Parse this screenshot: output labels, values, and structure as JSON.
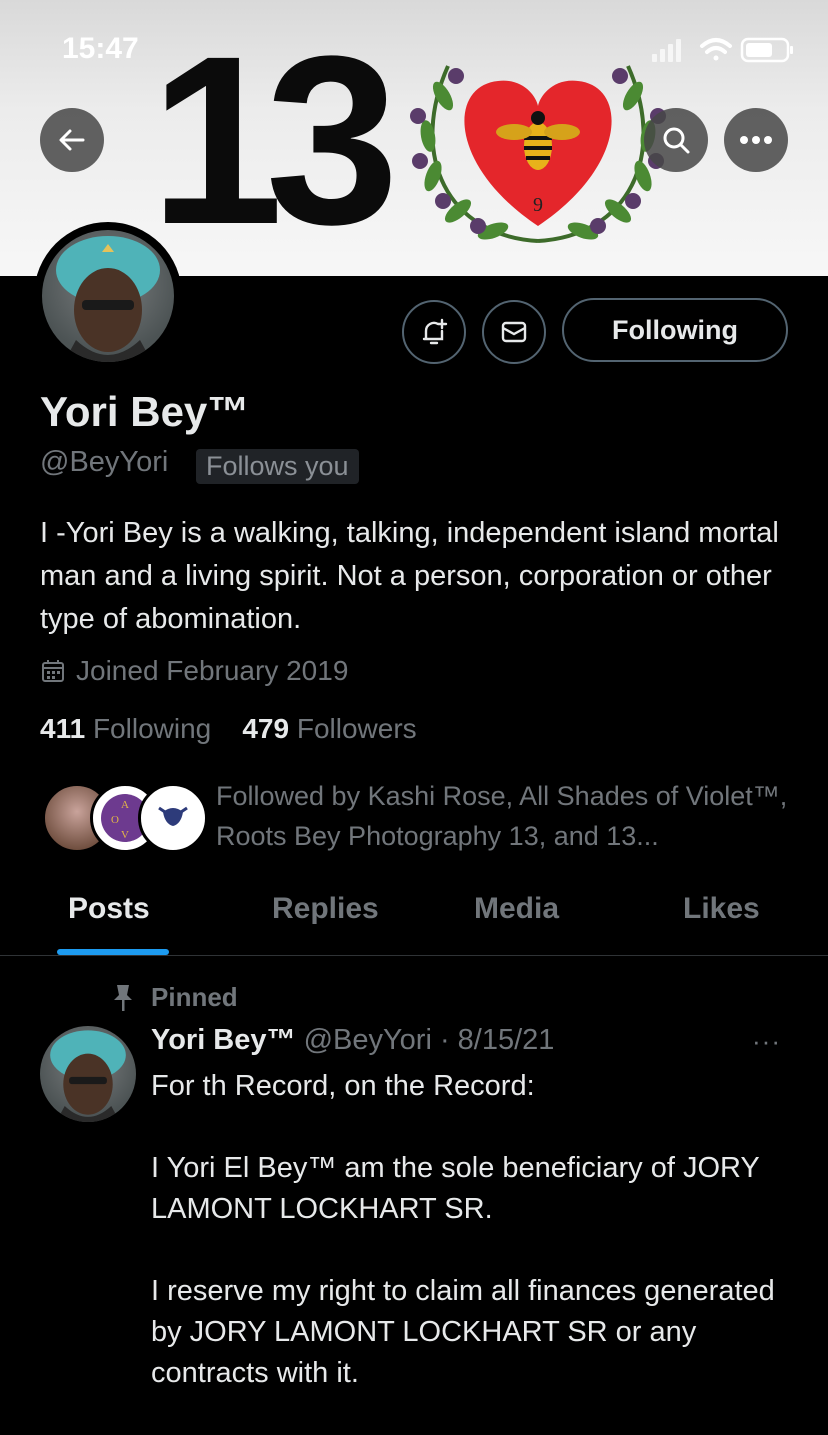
{
  "status_bar": {
    "time": "15:47"
  },
  "banner": {
    "number_text": "13",
    "heart_number": "9"
  },
  "profile": {
    "display_name": "Yori Bey™",
    "handle": "@BeyYori",
    "follows_you": "Follows you",
    "bio": "I -Yori Bey is a walking, talking, independent island mortal man and a living spirit. Not a person, corporation or other type of abomination.",
    "joined": "Joined February 2019",
    "following_count": "411",
    "following_label": "Following",
    "followers_count": "479",
    "followers_label": "Followers",
    "followed_by": "Followed by Kashi Rose, All Shades of Violet™, Roots Bey Photography 13, and 13...",
    "follow_button_label": "Following",
    "mini_avatar_letters": [
      "A",
      "O",
      "V"
    ]
  },
  "tabs": [
    {
      "label": "Posts",
      "active": true
    },
    {
      "label": "Replies",
      "active": false
    },
    {
      "label": "Media",
      "active": false
    },
    {
      "label": "Likes",
      "active": false
    }
  ],
  "pinned_post": {
    "pinned_label": "Pinned",
    "author_name": "Yori Bey™",
    "author_meta": "@BeyYori · 8/15/21",
    "more_label": "···",
    "paragraphs": [
      "For th Record, on the Record:",
      "I Yori El Bey™ am the sole beneficiary of JORY LAMONT LOCKHART SR.",
      "I reserve my right to claim all finances generated by JORY LAMONT LOCKHART SR or any contracts with it."
    ]
  },
  "colors": {
    "accent": "#1d9bf0",
    "muted": "#71767b",
    "text": "#e7e9ea",
    "border": "#536471"
  }
}
